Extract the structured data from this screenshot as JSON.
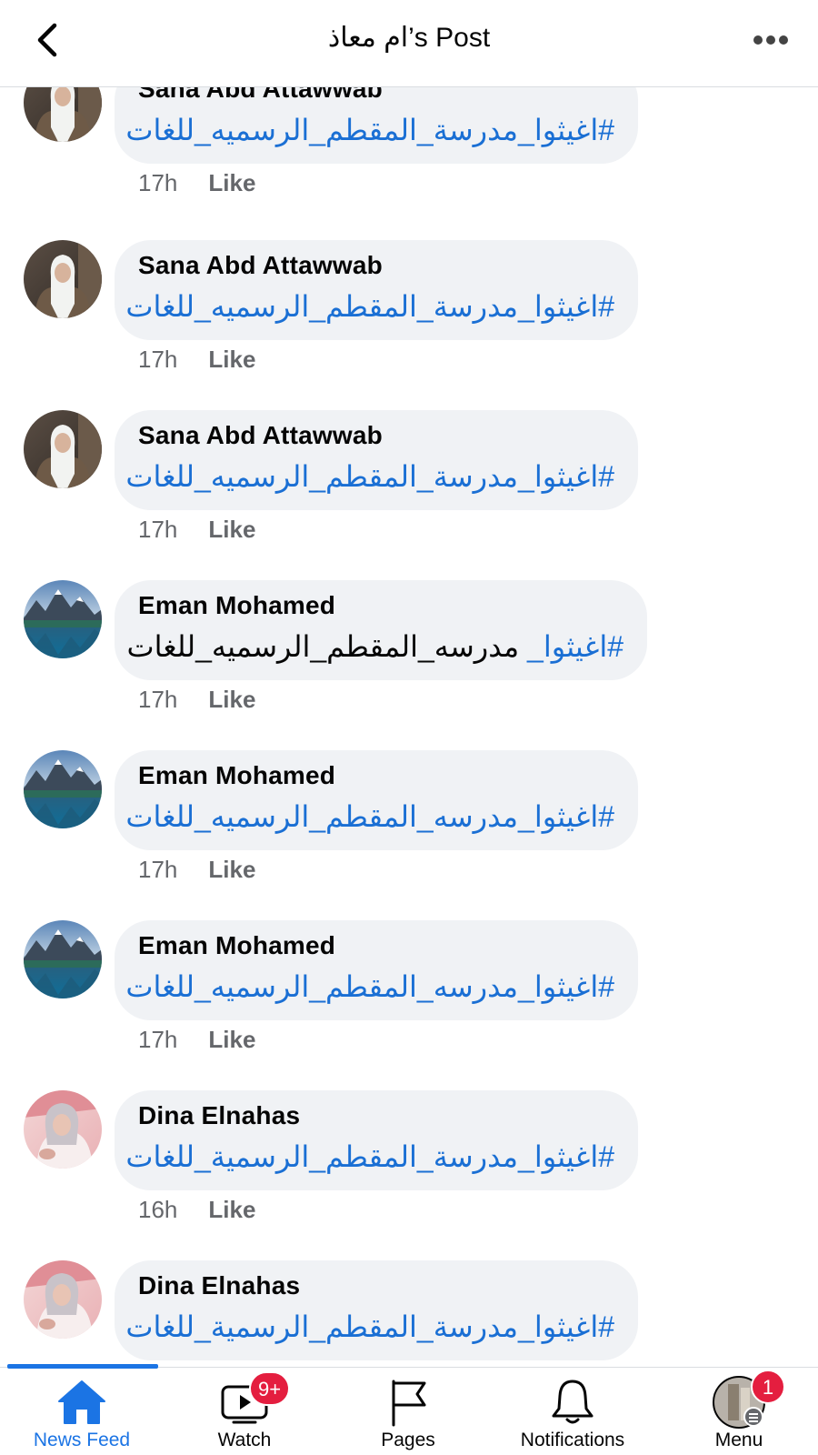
{
  "header": {
    "title": "ام معاذ’s Post",
    "back_icon": "chevron-left-icon",
    "more_icon": "more-horizontal-icon"
  },
  "comments": [
    {
      "name": "Sana Abd Attawwab",
      "text": "#اغيثوا_مدرسة_المقطم_الرسميه_للغات",
      "time": "17h",
      "like": "Like",
      "avatar": "woman-hijab"
    },
    {
      "name": "Sana Abd Attawwab",
      "text": "#اغيثوا_مدرسة_المقطم_الرسميه_للغات",
      "time": "17h",
      "like": "Like",
      "avatar": "woman-hijab"
    },
    {
      "name": "Sana Abd Attawwab",
      "text": "#اغيثوا_مدرسة_المقطم_الرسميه_للغات",
      "time": "17h",
      "like": "Like",
      "avatar": "woman-hijab"
    },
    {
      "name": "Eman Mohamed",
      "hashtag": "#اغيثوا_",
      "plain": "مدرسه_المقطم_الرسميه_للغات",
      "time": "17h",
      "like": "Like",
      "avatar": "mountain-lake"
    },
    {
      "name": "Eman Mohamed",
      "text": "#اغيثوا_مدرسه_المقطم_الرسميه_للغات",
      "time": "17h",
      "like": "Like",
      "avatar": "mountain-lake"
    },
    {
      "name": "Eman Mohamed",
      "text": "#اغيثوا_مدرسه_المقطم_الرسميه_للغات",
      "time": "17h",
      "like": "Like",
      "avatar": "mountain-lake"
    },
    {
      "name": "Dina Elnahas",
      "text": "#اغيثوا_مدرسة_المقطم_الرسمية_للغات",
      "time": "16h",
      "like": "Like",
      "avatar": "woman-pink"
    },
    {
      "name": "Dina Elnahas",
      "text": "#اغيثوا_مدرسة_المقطم_الرسمية_للغات",
      "avatar": "woman-pink"
    }
  ],
  "tabbar": {
    "tabs": [
      {
        "label": "News Feed",
        "icon": "home-icon",
        "active": true
      },
      {
        "label": "Watch",
        "icon": "video-icon",
        "badge": "9+"
      },
      {
        "label": "Pages",
        "icon": "flag-icon"
      },
      {
        "label": "Notifications",
        "icon": "bell-icon"
      },
      {
        "label": "Menu",
        "icon": "profile-menu-icon",
        "badge": "1"
      }
    ]
  },
  "colors": {
    "accent": "#1b74e4",
    "link": "#1a6fd4",
    "bubble": "#f0f2f5",
    "secondary_text": "#65676b",
    "badge": "#e41e3f"
  }
}
